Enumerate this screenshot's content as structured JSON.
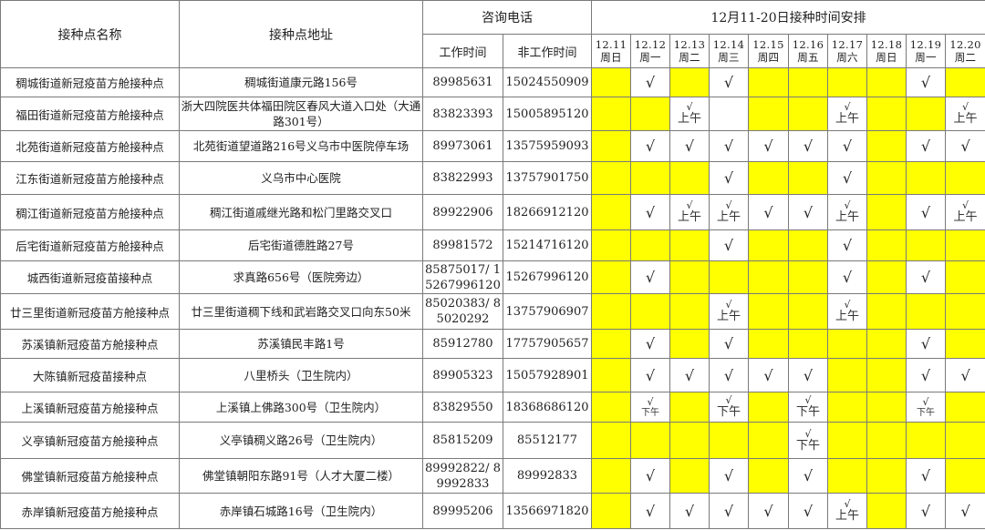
{
  "header": {
    "col_name": "接种点名称",
    "col_address": "接种点地址",
    "col_phone": "咨询电话",
    "col_phone_work": "工作时间",
    "col_phone_offwork": "非工作时间",
    "col_schedule": "12月11-20日接种时间安排"
  },
  "dates": [
    {
      "date": "12.11",
      "weekday": "周日"
    },
    {
      "date": "12.12",
      "weekday": "周一"
    },
    {
      "date": "12.13",
      "weekday": "周二"
    },
    {
      "date": "12.14",
      "weekday": "周三"
    },
    {
      "date": "12.15",
      "weekday": "周四"
    },
    {
      "date": "12.16",
      "weekday": "周五"
    },
    {
      "date": "12.17",
      "weekday": "周六"
    },
    {
      "date": "12.18",
      "weekday": "周日"
    },
    {
      "date": "12.19",
      "weekday": "周一"
    },
    {
      "date": "12.20",
      "weekday": "周二"
    }
  ],
  "legend": {
    "check": "√",
    "morning": "上午",
    "afternoon": "下午",
    "closed_color": "#FFFF00",
    "open_color": "#FFFFFF"
  },
  "rows": [
    {
      "name": "稠城街道新冠疫苗方舱接种点",
      "address": "稠城街道康元路156号",
      "phone_work": "89985631",
      "phone_offwork": "15024550909",
      "schedule": [
        "off",
        "on",
        "off",
        "on",
        "off",
        "off",
        "off",
        "off",
        "on",
        "off"
      ]
    },
    {
      "name": "福田街道新冠疫苗方舱接种点",
      "address": "浙大四院医共体福田院区春风大道入口处（大通路301号）",
      "phone_work": "83823393",
      "phone_offwork": "15005895120",
      "schedule": [
        "off",
        "off",
        "am",
        "blank",
        "off",
        "off",
        "am",
        "off",
        "off",
        "am"
      ]
    },
    {
      "name": "北苑街道新冠疫苗方舱接种点",
      "address": "北苑街道望道路216号义乌市中医院停车场",
      "phone_work": "89973061",
      "phone_offwork": "13575959093",
      "schedule": [
        "off",
        "on",
        "on",
        "on",
        "on",
        "on",
        "on",
        "off",
        "on",
        "on"
      ]
    },
    {
      "name": "江东街道新冠疫苗方舱接种点",
      "address": "义乌市中心医院",
      "phone_work": "83822993",
      "phone_offwork": "13757901750",
      "schedule": [
        "off",
        "off",
        "off",
        "on",
        "off",
        "off",
        "on",
        "off",
        "off",
        "off"
      ]
    },
    {
      "name": "稠江街道新冠疫苗方舱接种点",
      "address": "稠江街道戚继光路和松门里路交叉口",
      "phone_work": "89922906",
      "phone_offwork": "18266912120",
      "schedule": [
        "off",
        "on",
        "am",
        "am",
        "on",
        "on",
        "am",
        "off",
        "on",
        "am"
      ]
    },
    {
      "name": "后宅街道新冠疫苗方舱接种点",
      "address": "后宅街道德胜路27号",
      "phone_work": "89981572",
      "phone_offwork": "15214716120",
      "schedule": [
        "off",
        "off",
        "off",
        "on",
        "off",
        "off",
        "on",
        "off",
        "off",
        "off"
      ]
    },
    {
      "name": "城西街道新冠疫苗接种点",
      "address": "求真路656号（医院旁边）",
      "phone_work": "85875017/ 15267996120",
      "phone_offwork": "15267996120",
      "schedule": [
        "off",
        "on",
        "off",
        "off",
        "off",
        "off",
        "on",
        "off",
        "on",
        "off"
      ]
    },
    {
      "name": "廿三里街道新冠疫苗方舱接种点",
      "address": "廿三里街道稠下线和武岩路交叉口向东50米",
      "phone_work": "85020383/ 85020292",
      "phone_offwork": "13757906907",
      "schedule": [
        "off",
        "off",
        "off",
        "am",
        "off",
        "off",
        "am",
        "off",
        "off",
        "off"
      ]
    },
    {
      "name": "苏溪镇新冠疫苗方舱接种点",
      "address": "苏溪镇民丰路1号",
      "phone_work": "85912780",
      "phone_offwork": "17757905657",
      "schedule": [
        "off",
        "on",
        "off",
        "on",
        "off",
        "off",
        "off",
        "off",
        "on",
        "off"
      ]
    },
    {
      "name": "大陈镇新冠疫苗接种点",
      "address": "八里桥头（卫生院内）",
      "phone_work": "89905323",
      "phone_offwork": "15057928901",
      "schedule": [
        "off",
        "on",
        "on",
        "on",
        "on",
        "on",
        "off",
        "off",
        "on",
        "on"
      ]
    },
    {
      "name": "上溪镇新冠疫苗方舱接种点",
      "address": "上溪镇上佛路300号（卫生院内）",
      "phone_work": "83829550",
      "phone_offwork": "18368686120",
      "schedule": [
        "off",
        "pm-s",
        "off",
        "pm",
        "off",
        "pm",
        "off",
        "off",
        "pm-s",
        "off"
      ]
    },
    {
      "name": "义亭镇新冠疫苗方舱接种点",
      "address": "义亭镇稠义路26号（卫生院内）",
      "phone_work": "85815209",
      "phone_offwork": "85512177",
      "schedule": [
        "off",
        "off",
        "off",
        "off",
        "off",
        "pm",
        "off",
        "off",
        "off",
        "off"
      ]
    },
    {
      "name": "佛堂镇新冠疫苗方舱接种点",
      "address": "佛堂镇朝阳东路91号（人才大厦二楼）",
      "phone_work": "89992822/ 89992833",
      "phone_offwork": "89992833",
      "schedule": [
        "off",
        "on",
        "off",
        "on",
        "off",
        "on",
        "off",
        "off",
        "on",
        "off"
      ]
    },
    {
      "name": "赤岸镇新冠疫苗方舱接种点",
      "address": "赤岸镇石城路16号（卫生院内）",
      "phone_work": "89995206",
      "phone_offwork": "13566971820",
      "schedule": [
        "off",
        "on",
        "on",
        "on",
        "on",
        "on",
        "am",
        "off",
        "on",
        "on"
      ]
    }
  ]
}
